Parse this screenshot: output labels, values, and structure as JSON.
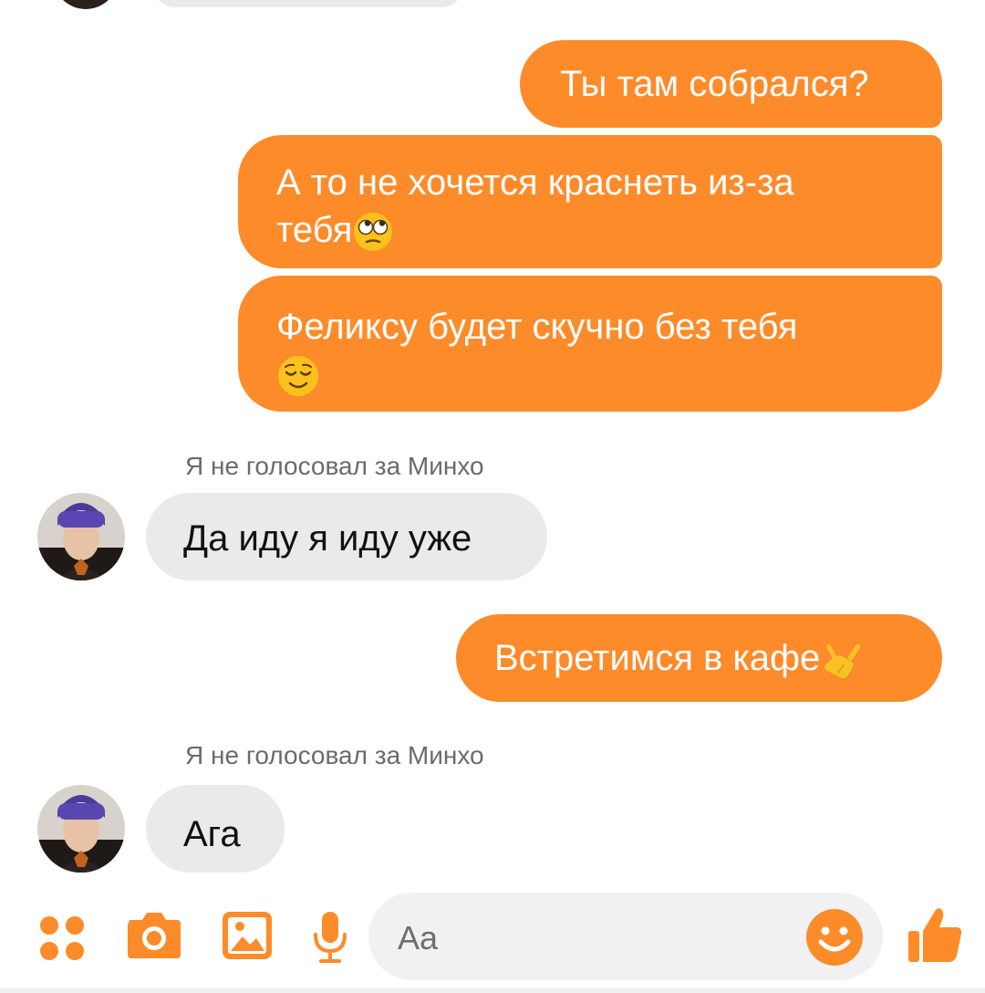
{
  "colors": {
    "accent": "#fd8b2a",
    "incoming_bubble": "#eaeaec",
    "composer_bg": "#f1f1f3",
    "sender_text": "#6b6b6b"
  },
  "messages": {
    "m1": "Ты там собрался?",
    "m2_line1": "А то не хочется краснеть из-за",
    "m2_line2": "тебя",
    "m3_line1": "Феликсу будет скучно без тебя",
    "m4": "Встретимся в кафе",
    "sender_1": "Я не голосовал за Минхо",
    "reply_1": "Да иду я иду уже",
    "sender_2": "Я не голосовал за Минхо",
    "reply_2": "Ага"
  },
  "emojis": {
    "m2": "face-with-rolling-eyes",
    "m3": "relieved-face",
    "m4": "call-me-hand"
  },
  "composer": {
    "placeholder": "Aa"
  },
  "toolbar_icons": [
    "more-apps-icon",
    "camera-icon",
    "gallery-icon",
    "microphone-icon",
    "emoji-icon",
    "thumbs-up-icon"
  ]
}
